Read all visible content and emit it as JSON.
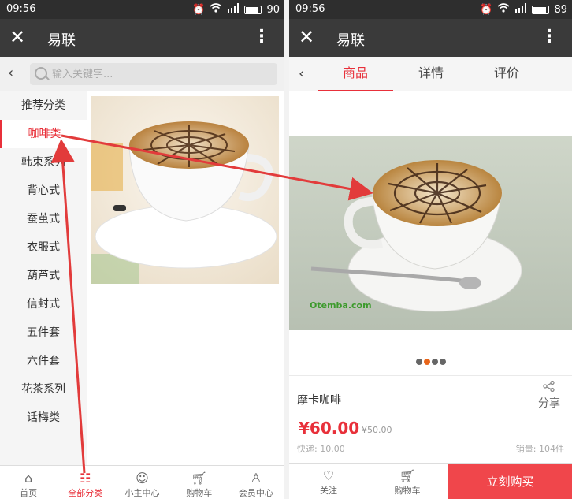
{
  "left": {
    "status": {
      "time": "09:56",
      "battery": "90"
    },
    "app_title": "易联",
    "search": {
      "placeholder": "输入关键字..."
    },
    "categories": [
      "推荐分类",
      "咖啡类",
      "韩束系列",
      "背心式",
      "蚕茧式",
      "衣服式",
      "葫芦式",
      "信封式",
      "五件套",
      "六件套",
      "花茶系列",
      "话梅类"
    ],
    "active_category": "咖啡类",
    "bottom_nav": [
      "首页",
      "全部分类",
      "小主中心",
      "购物车",
      "会员中心"
    ],
    "active_nav": "全部分类"
  },
  "right": {
    "status": {
      "time": "09:56",
      "battery": "89"
    },
    "app_title": "易联",
    "tabs": [
      "商品",
      "详情",
      "评价"
    ],
    "active_tab": "商品",
    "product": {
      "name": "摩卡咖啡",
      "price": "¥60.00",
      "old_price": "¥50.00",
      "shipping": "快递: 10.00",
      "sales": "销量: 104件",
      "share": "分享",
      "watermark": "Otemba.com"
    },
    "carousel": {
      "count": 4,
      "active_index": 1
    },
    "bottom": {
      "follow": "关注",
      "cart": "购物车",
      "buy": "立刻购买"
    }
  },
  "colors": {
    "accent": "#e8303a",
    "buy_button": "#f0464b",
    "titlebar": "#3a3a3a",
    "statusbar": "#2e2e2e",
    "arrow": "#e23b3b"
  }
}
